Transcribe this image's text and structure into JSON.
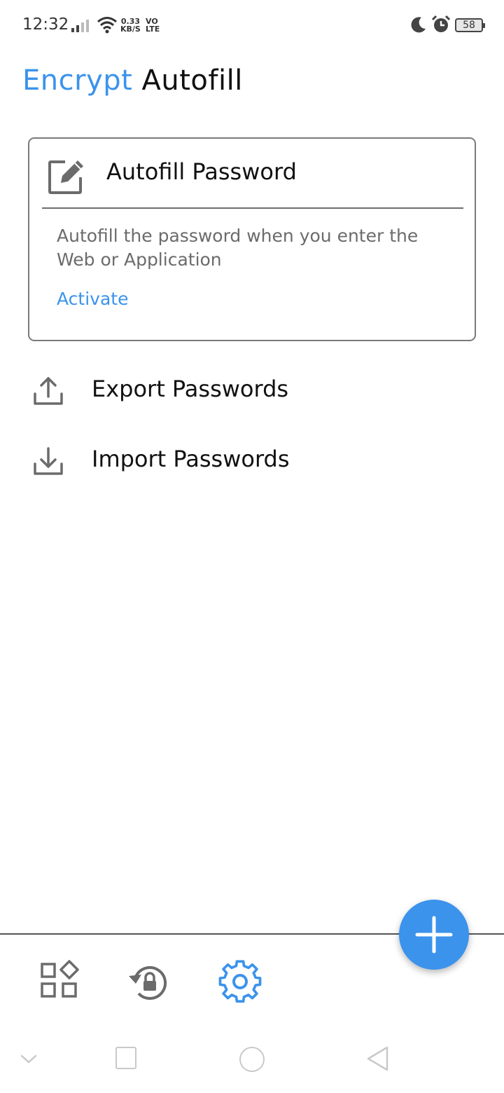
{
  "status_bar": {
    "time": "12:32",
    "net_speed_value": "0.33",
    "net_speed_unit": "KB/S",
    "volte_top": "VO",
    "volte_bottom": "LTE",
    "battery_level": "58"
  },
  "header": {
    "title_accent": "Encrypt",
    "title_rest": "Autofill"
  },
  "autofill_card": {
    "title": "Autofill Password",
    "description": "Autofill the password when you enter the Web or Application",
    "action_label": "Activate",
    "icon": "edit-icon"
  },
  "actions": [
    {
      "label": "Export Passwords",
      "icon": "upload-icon"
    },
    {
      "label": "Import Passwords",
      "icon": "download-icon"
    }
  ],
  "bottom_nav": {
    "items": [
      {
        "icon": "apps-grid-icon",
        "active": false
      },
      {
        "icon": "history-lock-icon",
        "active": false
      },
      {
        "icon": "gear-icon",
        "active": true
      }
    ],
    "fab_icon": "plus-icon"
  },
  "colors": {
    "accent": "#3b93ec",
    "text_primary": "#111111",
    "text_secondary": "#6b6b6b",
    "icon_gray": "#6b6b6b"
  }
}
